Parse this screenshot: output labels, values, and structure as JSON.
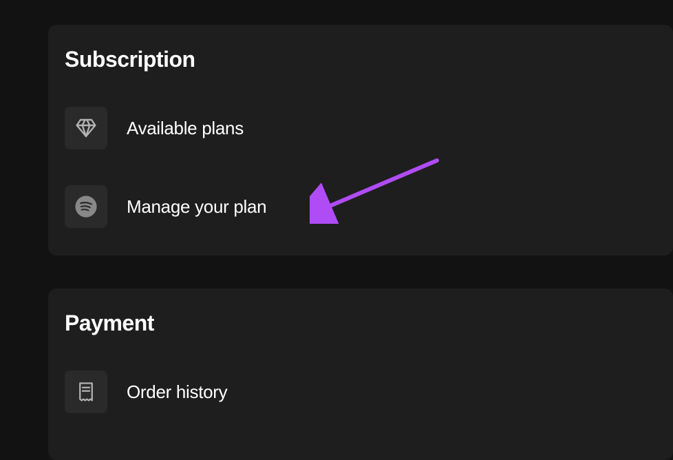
{
  "sections": {
    "subscription": {
      "title": "Subscription",
      "items": [
        {
          "label": "Available plans",
          "icon": "diamond-icon"
        },
        {
          "label": "Manage your plan",
          "icon": "spotify-icon"
        }
      ]
    },
    "payment": {
      "title": "Payment",
      "items": [
        {
          "label": "Order history",
          "icon": "receipt-icon"
        }
      ]
    }
  },
  "annotation": {
    "arrow_color": "#b04cf5",
    "target": "manage-your-plan"
  }
}
